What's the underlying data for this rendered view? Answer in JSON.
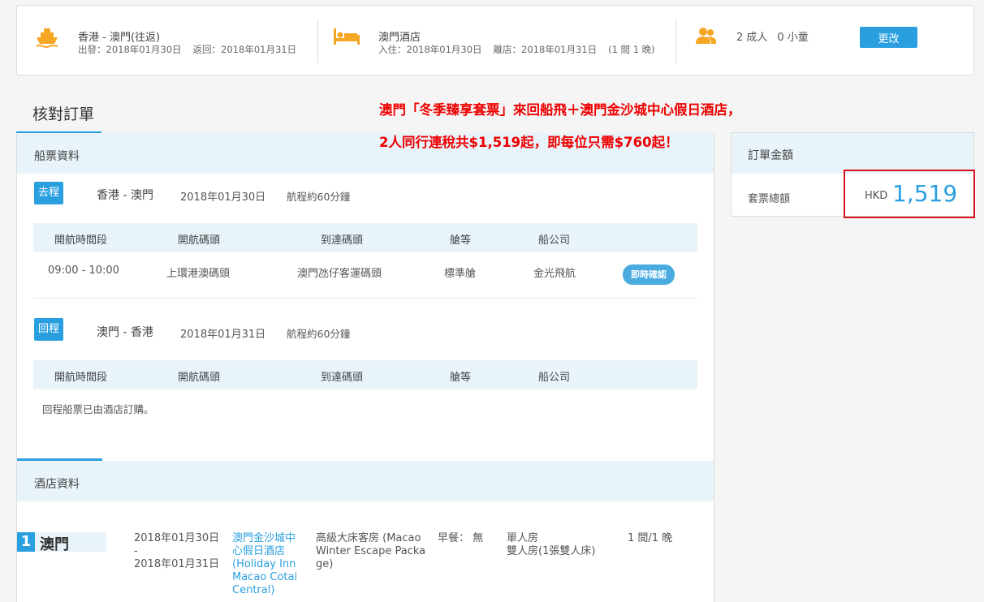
{
  "summary": {
    "ferry": {
      "icon": "ferry-icon",
      "title": "香港 - 澳門(往返)",
      "depart": "出發：2018年01月30日",
      "return": "返回：2018年01月31日"
    },
    "hotel": {
      "icon": "bed-icon",
      "title": "澳門酒店",
      "checkin": "入住：2018年01月30日",
      "checkout": "離店：2018年01月31日",
      "rooms": "(1 間 1 晚)"
    },
    "pax": {
      "icon": "people-icon",
      "adults": "2 成人",
      "children": "0 小童"
    },
    "change_label": "更改"
  },
  "page_title": "核對訂單",
  "promo": {
    "line1": "澳門「冬季臻享套票」來回船飛＋澳門金沙城中心假日酒店，",
    "line2": "2人同行連稅共$1,519起，即每位只需$760起！"
  },
  "ferry_section": {
    "title": "船票資料",
    "columns": [
      "開航時間段",
      "開航碼頭",
      "到達碼頭",
      "艙等",
      "船公司"
    ],
    "outbound": {
      "badge": "去程",
      "route": "香港 - 澳門",
      "date": "2018年01月30日",
      "duration": "航程約60分鐘",
      "row": {
        "time": "09:00 - 10:00",
        "from": "上環港澳碼頭",
        "to": "澳門氹仔客運碼頭",
        "class": "標準艙",
        "company": "金光飛航",
        "status": "即時確認"
      }
    },
    "return": {
      "badge": "回程",
      "route": "澳門 - 香港",
      "date": "2018年01月31日",
      "duration": "航程約60分鐘",
      "note": "回程船票已由酒店訂購。"
    }
  },
  "hotel_section": {
    "title": "酒店資料",
    "number": "1",
    "city": "澳門",
    "date_from": "2018年01月30日",
    "date_sep": "-",
    "date_to": "2018年01月31日",
    "hotel_name": [
      "澳門金沙城中",
      "心假日酒店",
      "(Holiday Inn",
      "Macao Cotai",
      "Central)"
    ],
    "room_type": [
      "高級大床客房 (Macao",
      "Winter Escape Packa",
      "ge)"
    ],
    "breakfast": "早餐： 無",
    "room_config": [
      "單人房",
      "雙人房(1張雙人床)"
    ],
    "room_count": "1 間/1 晚"
  },
  "order_total": {
    "title": "訂單金額",
    "label": "套票總額",
    "currency": "HKD",
    "amount": "1,519"
  },
  "colors": {
    "accent": "#2a9fe0",
    "promo": "#ee0000",
    "highlight_box": "#d9121b"
  }
}
